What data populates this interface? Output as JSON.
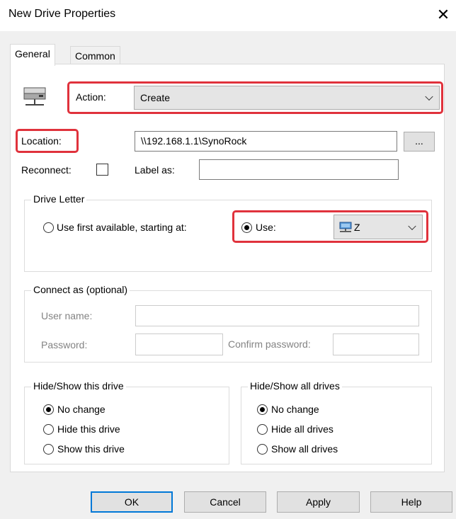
{
  "window": {
    "title": "New Drive Properties"
  },
  "tabs": [
    {
      "label": "General",
      "active": true
    },
    {
      "label": "Common",
      "active": false
    }
  ],
  "action": {
    "label": "Action:",
    "value": "Create"
  },
  "location": {
    "label": "Location:",
    "value": "\\\\192.168.1.1\\SynoRock",
    "browse_label": "..."
  },
  "reconnect": {
    "label": "Reconnect:",
    "checked": false
  },
  "label_as": {
    "label": "Label as:",
    "value": ""
  },
  "drive_letter": {
    "legend": "Drive Letter",
    "first_available_label": "Use first available, starting at:",
    "use_label": "Use:",
    "letter": "Z",
    "selected": "use"
  },
  "connect_as": {
    "legend": "Connect as (optional)",
    "username_label": "User name:",
    "username_value": "",
    "password_label": "Password:",
    "password_value": "",
    "confirm_label": "Confirm password:",
    "confirm_value": ""
  },
  "hide_show_drive": {
    "legend": "Hide/Show this drive",
    "options": [
      "No change",
      "Hide this drive",
      "Show this drive"
    ],
    "selected": 0
  },
  "hide_show_all": {
    "legend": "Hide/Show all drives",
    "options": [
      "No change",
      "Hide all drives",
      "Show all drives"
    ],
    "selected": 0
  },
  "buttons": {
    "ok": "OK",
    "cancel": "Cancel",
    "apply": "Apply",
    "help": "Help"
  },
  "colors": {
    "highlight": "#e0323c",
    "focus": "#0078d7",
    "dialog_bg": "#f0f0f0"
  }
}
